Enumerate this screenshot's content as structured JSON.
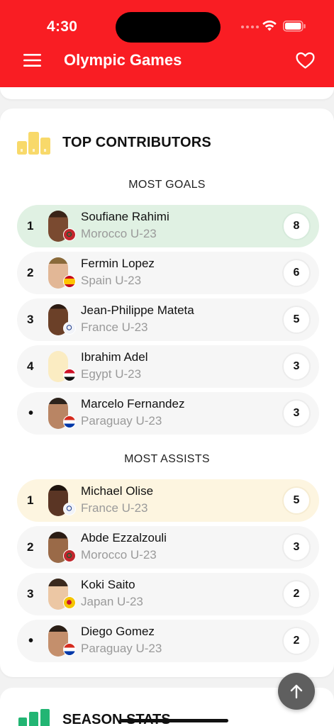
{
  "status_bar": {
    "time": "4:30"
  },
  "app_bar": {
    "title": "Olympic Games"
  },
  "top_contributors": {
    "title": "TOP CONTRIBUTORS",
    "goals": {
      "heading": "MOST GOALS",
      "players": [
        {
          "rank": "1",
          "name": "Soufiane Rahimi",
          "team": "Morocco U-23",
          "value": "8",
          "flag": "morocco-flag-icon"
        },
        {
          "rank": "2",
          "name": "Fermin Lopez",
          "team": "Spain U-23",
          "value": "6",
          "flag": "spain-flag-icon"
        },
        {
          "rank": "3",
          "name": "Jean-Philippe Mateta",
          "team": "France U-23",
          "value": "5",
          "flag": "france-flag-icon"
        },
        {
          "rank": "4",
          "name": "Ibrahim Adel",
          "team": "Egypt U-23",
          "value": "3",
          "flag": "egypt-flag-icon"
        },
        {
          "rank": "•",
          "name": "Marcelo Fernandez",
          "team": "Paraguay U-23",
          "value": "3",
          "flag": "paraguay-flag-icon"
        }
      ]
    },
    "assists": {
      "heading": "MOST ASSISTS",
      "players": [
        {
          "rank": "1",
          "name": "Michael Olise",
          "team": "France U-23",
          "value": "5",
          "flag": "france-flag-icon"
        },
        {
          "rank": "2",
          "name": "Abde Ezzalzouli",
          "team": "Morocco U-23",
          "value": "3",
          "flag": "morocco-flag-icon"
        },
        {
          "rank": "3",
          "name": "Koki Saito",
          "team": "Japan U-23",
          "value": "2",
          "flag": "japan-flag-icon"
        },
        {
          "rank": "•",
          "name": "Diego Gomez",
          "team": "Paraguay U-23",
          "value": "2",
          "flag": "paraguay-flag-icon"
        }
      ]
    }
  },
  "season_stats": {
    "title": "SEASON STATS"
  },
  "colors": {
    "brand_red": "#f91d23",
    "goals_highlight": "#e0f1e3",
    "assists_highlight": "#fdf5e0",
    "trophy_yellow": "#f8d96a",
    "stats_green": "#22b573"
  }
}
